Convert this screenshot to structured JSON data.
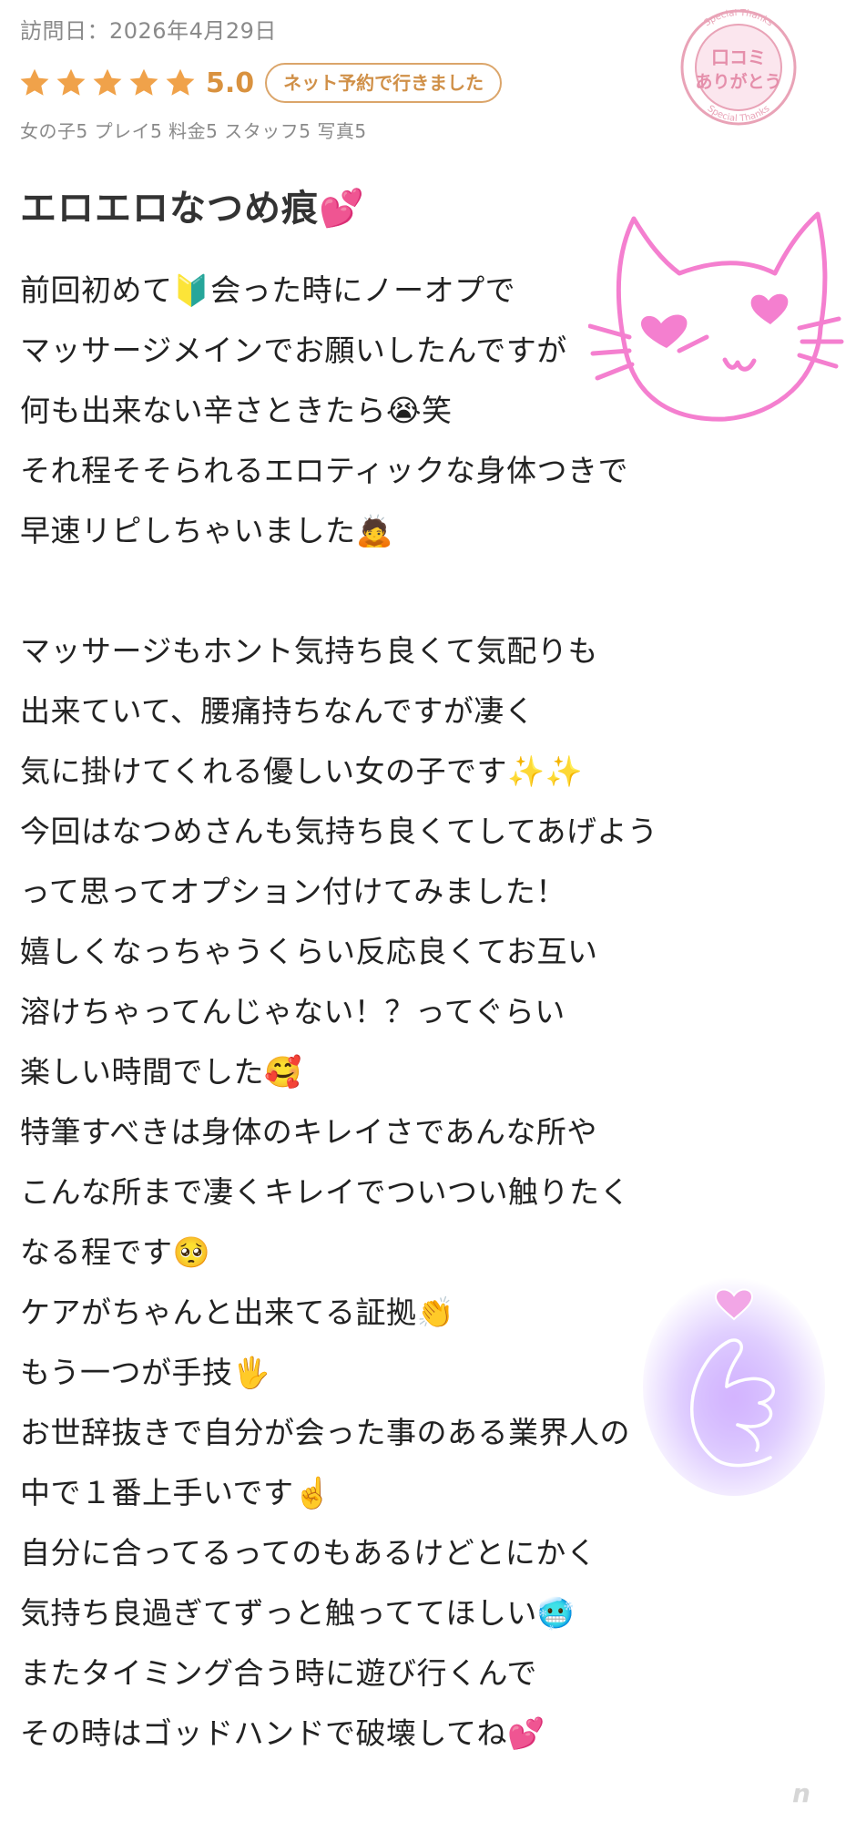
{
  "review": {
    "visit_date": "訪問日：2026年4月29日",
    "score": "5.0",
    "star_count": 5,
    "booking_badge": "ネット予約で行きました",
    "sub_scores": "女の子5 プレイ5 料金5 スタッフ5 写真5",
    "title": "エロエロなつめ痕💕",
    "lines": [
      "前回初めて🔰会った時にノーオプで",
      "マッサージメインでお願いしたんですが",
      "何も出来ない辛さときたら😭笑",
      "それ程そそられるエロティックな身体つきで",
      "早速リピしちゃいました🙇",
      "",
      "マッサージもホント気持ち良くて気配りも",
      "出来ていて、腰痛持ちなんですが凄く",
      "気に掛けてくれる優しい女の子です✨✨",
      "今回はなつめさんも気持ち良くてしてあげよう",
      "って思ってオプション付けてみました！",
      "嬉しくなっちゃうくらい反応良くてお互い",
      "溶けちゃってんじゃない！？ってぐらい",
      "楽しい時間でした🥰",
      "特筆すべきは身体のキレイさであんな所や",
      "こんな所まで凄くキレイでついつい触りたく",
      "なる程です🥺",
      "ケアがちゃんと出来てる証拠👏",
      "もう一つが手技🖐",
      "お世辞抜きで自分が会った事のある業界人の",
      "中で１番上手いです☝️",
      "自分に合ってるってのもあるけどとにかく",
      "気持ち良過ぎてずっと触っててほしい🥶",
      "またタイミング合う時に遊び行くんで",
      "その時はゴッドハンドで破壊してね💕"
    ]
  },
  "stamp": {
    "main_text_1": "口コミ",
    "main_text_2": "ありがとう",
    "ring_text": "Special Thanks"
  },
  "decorations": {
    "cat_doodle": "cat-face-doodle",
    "heart_hand": "finger-heart-neon"
  },
  "colors": {
    "star": "#f0a24a",
    "score": "#d9923f",
    "badge_border": "#dba56a",
    "stamp_pink": "#e9a3b7",
    "doodle_pink": "#f47fcf",
    "neon_purple": "#b37cff"
  },
  "watermark": "n"
}
